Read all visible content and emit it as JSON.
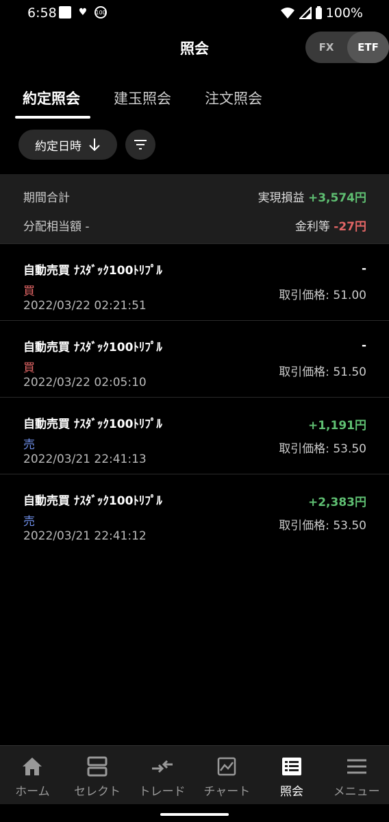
{
  "status_bar": {
    "time": "6:58",
    "badge": "100",
    "battery": "100%"
  },
  "header": {
    "title": "照会",
    "segment": [
      {
        "label": "FX",
        "active": false
      },
      {
        "label": "ETF",
        "active": true
      }
    ]
  },
  "tabs": [
    {
      "label": "約定照会",
      "active": true
    },
    {
      "label": "建玉照会",
      "active": false
    },
    {
      "label": "注文照会",
      "active": false
    }
  ],
  "sort": {
    "label": "約定日時"
  },
  "summary": {
    "period_label": "期間合計",
    "realized_label": "実現損益",
    "realized_value": "+3,574円",
    "dividend_label": "分配相当額",
    "dividend_value": "-",
    "interest_label": "金利等",
    "interest_value": "-27円"
  },
  "trades": [
    {
      "name": "自動売買 ﾅｽﾀﾞｯｸ100ﾄﾘﾌﾟﾙ",
      "side": "買",
      "side_type": "buy",
      "datetime": "2022/03/22 02:21:51",
      "pnl": "-",
      "price": "取引価格: 51.00"
    },
    {
      "name": "自動売買 ﾅｽﾀﾞｯｸ100ﾄﾘﾌﾟﾙ",
      "side": "買",
      "side_type": "buy",
      "datetime": "2022/03/22 02:05:10",
      "pnl": "-",
      "price": "取引価格: 51.50"
    },
    {
      "name": "自動売買 ﾅｽﾀﾞｯｸ100ﾄﾘﾌﾟﾙ",
      "side": "売",
      "side_type": "sell",
      "datetime": "2022/03/21 22:41:13",
      "pnl": "+1,191円",
      "price": "取引価格: 53.50"
    },
    {
      "name": "自動売買 ﾅｽﾀﾞｯｸ100ﾄﾘﾌﾟﾙ",
      "side": "売",
      "side_type": "sell",
      "datetime": "2022/03/21 22:41:12",
      "pnl": "+2,383円",
      "price": "取引価格: 53.50"
    }
  ],
  "bottom_nav": [
    {
      "label": "ホーム",
      "icon": "home-icon",
      "active": false
    },
    {
      "label": "セレクト",
      "icon": "select-icon",
      "active": false
    },
    {
      "label": "トレード",
      "icon": "trade-icon",
      "active": false
    },
    {
      "label": "チャート",
      "icon": "chart-icon",
      "active": false
    },
    {
      "label": "照会",
      "icon": "inquiry-icon",
      "active": true
    },
    {
      "label": "メニュー",
      "icon": "menu-icon",
      "active": false
    }
  ],
  "colors": {
    "positive": "#5fbf72",
    "negative": "#e26565",
    "sell": "#6f8fe8"
  }
}
